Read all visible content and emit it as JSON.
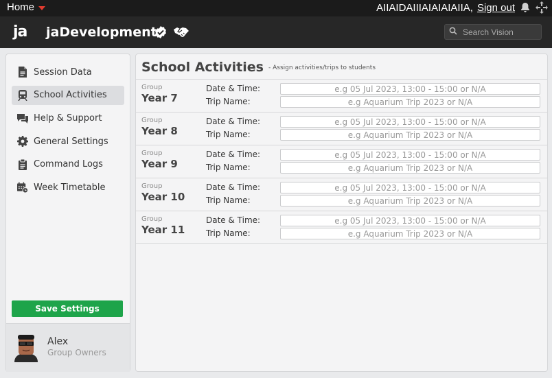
{
  "topbar": {
    "home_label": "Home",
    "username": "AIIAIDAIIIAIAIAIAIIA,",
    "signout_label": "Sign out",
    "icons": [
      "chevron-down-icon",
      "bell-icon",
      "move-icon"
    ]
  },
  "header": {
    "logo": "ja",
    "brand": "jaDevelopment",
    "icons": [
      "verified-badge-icon",
      "partner-handshake-icon"
    ],
    "search_placeholder": "Search Vision"
  },
  "sidebar": {
    "items": [
      {
        "label": "Session Data",
        "icon": "document-icon",
        "active": false
      },
      {
        "label": "School Activities",
        "icon": "train-icon",
        "active": true
      },
      {
        "label": "Help & Support",
        "icon": "chat-icon",
        "active": false
      },
      {
        "label": "General Settings",
        "icon": "gear-icon",
        "active": false
      },
      {
        "label": "Command Logs",
        "icon": "clipboard-icon",
        "active": false
      },
      {
        "label": "Week Timetable",
        "icon": "calendar-clock-icon",
        "active": false
      }
    ],
    "save_label": "Save Settings",
    "user": {
      "name": "Alex",
      "role": "Group Owners"
    }
  },
  "main": {
    "title": "School Activities",
    "subtitle": "- Assign activities/trips to students",
    "date_label": "Date & Time:",
    "trip_label": "Trip Name:",
    "group_label": "Group",
    "date_placeholder": "e.g 05 Jul 2023, 13:00 - 15:00 or N/A",
    "trip_placeholder": "e.g Aquarium Trip 2023 or N/A",
    "groups": [
      "Year 7",
      "Year 8",
      "Year 9",
      "Year 10",
      "Year 11"
    ]
  },
  "colors": {
    "accent": "#1ea44a",
    "caret": "#e23b2f",
    "header": "#272727",
    "topbar": "#1b1b1b"
  }
}
